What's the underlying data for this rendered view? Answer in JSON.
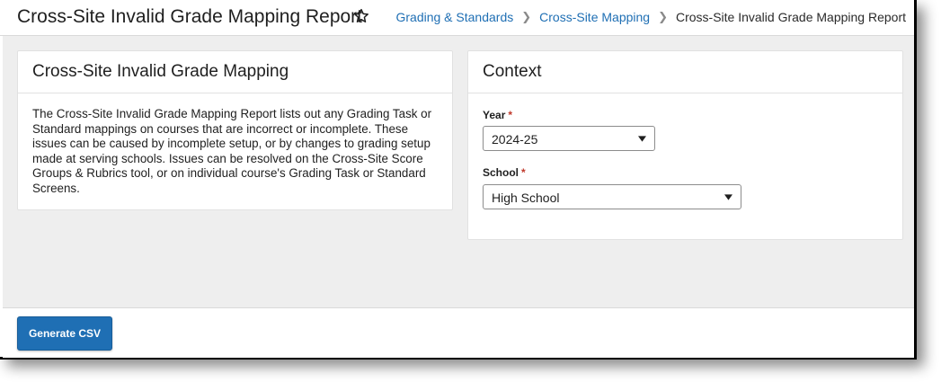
{
  "header": {
    "title": "Cross-Site Invalid Grade Mapping Report",
    "favorite_icon": "star-outline-icon",
    "breadcrumb": [
      {
        "label": "Grading & Standards"
      },
      {
        "label": "Cross-Site Mapping"
      },
      {
        "label": "Cross-Site Invalid Grade Mapping Report"
      }
    ]
  },
  "info_card": {
    "title": "Cross-Site Invalid Grade Mapping",
    "description": "The Cross-Site Invalid Grade Mapping Report lists out any Grading Task or Standard mappings on courses that are incorrect or incomplete. These issues can be caused by incomplete setup, or by changes to grading setup made at serving schools. Issues can be resolved on the Cross-Site Score Groups & Rubrics tool, or on individual course's Grading Task or Standard Screens."
  },
  "context_card": {
    "title": "Context",
    "year": {
      "label": "Year",
      "required_marker": "*",
      "value": "2024-25"
    },
    "school": {
      "label": "School",
      "required_marker": "*",
      "value": "High School"
    }
  },
  "footer": {
    "generate_label": "Generate CSV"
  },
  "colors": {
    "accent": "#1f6fb4",
    "content_bg": "#eeeeee",
    "required": "#c0392b"
  }
}
